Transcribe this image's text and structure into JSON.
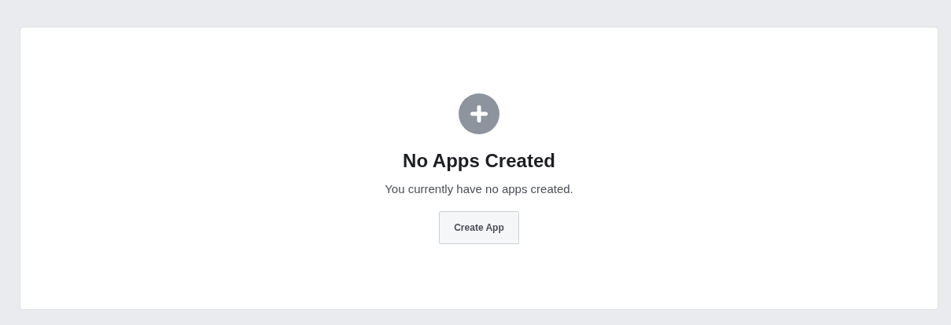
{
  "empty_state": {
    "title": "No Apps Created",
    "message": "You currently have no apps created.",
    "button": "Create App"
  }
}
